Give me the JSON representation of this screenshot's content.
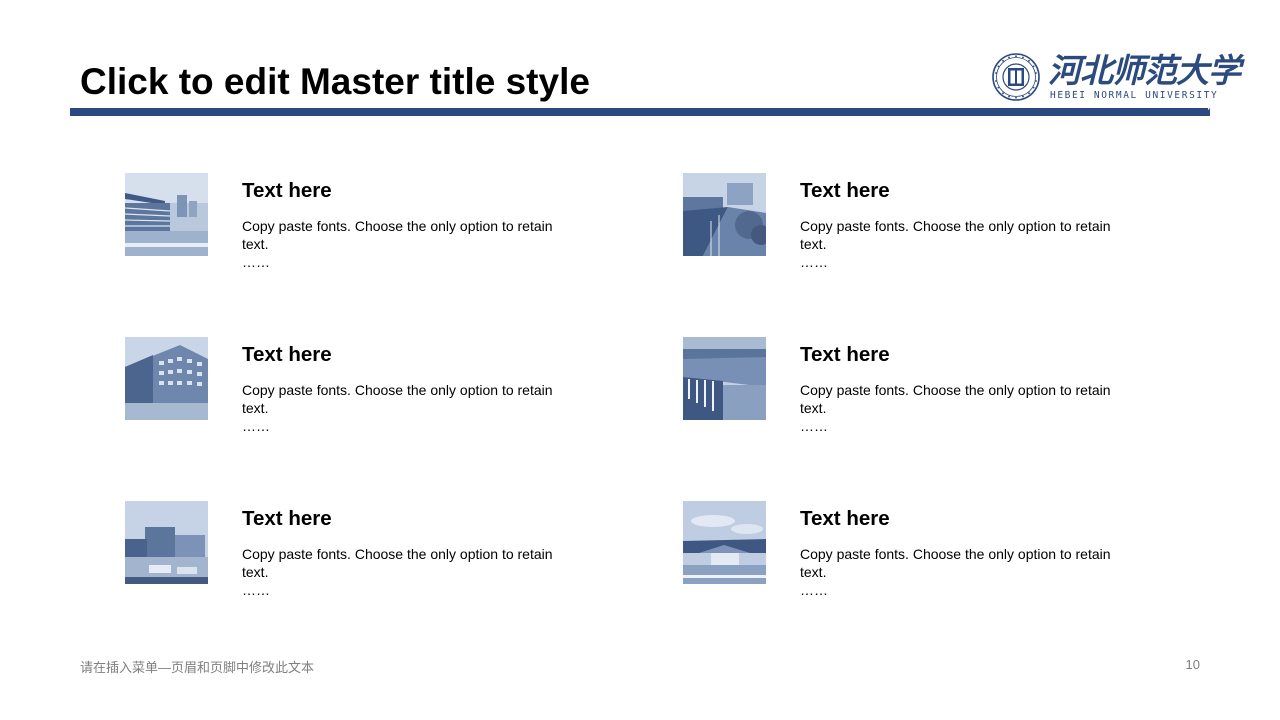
{
  "slide": {
    "title": "Click to edit Master title style",
    "page_number": "10",
    "footer": "请在插入菜单—页眉和页脚中修改此文本",
    "accent_color": "#2b4a7f"
  },
  "logo": {
    "name_cn": "河北师范大学",
    "name_en": "HEBEI NORMAL UNIVERSITY",
    "seal_icon": "university-seal-icon"
  },
  "cards": [
    {
      "heading": "Text here",
      "body": "Copy paste fonts. Choose the only option to retain text.",
      "ellipsis": "……",
      "photo": "stadium-photo"
    },
    {
      "heading": "Text here",
      "body": "Copy paste fonts. Choose the only option to retain text.",
      "ellipsis": "……",
      "photo": "riverside-walkway-photo"
    },
    {
      "heading": "Text here",
      "body": "Copy paste fonts. Choose the only option to retain text.",
      "ellipsis": "……",
      "photo": "academic-building-photo"
    },
    {
      "heading": "Text here",
      "body": "Copy paste fonts. Choose the only option to retain text.",
      "ellipsis": "……",
      "photo": "waterfall-pond-photo"
    },
    {
      "heading": "Text here",
      "body": "Copy paste fonts. Choose the only option to retain text.",
      "ellipsis": "……",
      "photo": "campus-plaza-photo"
    },
    {
      "heading": "Text here",
      "body": "Copy paste fonts. Choose the only option to retain text.",
      "ellipsis": "……",
      "photo": "campus-gate-photo"
    }
  ]
}
